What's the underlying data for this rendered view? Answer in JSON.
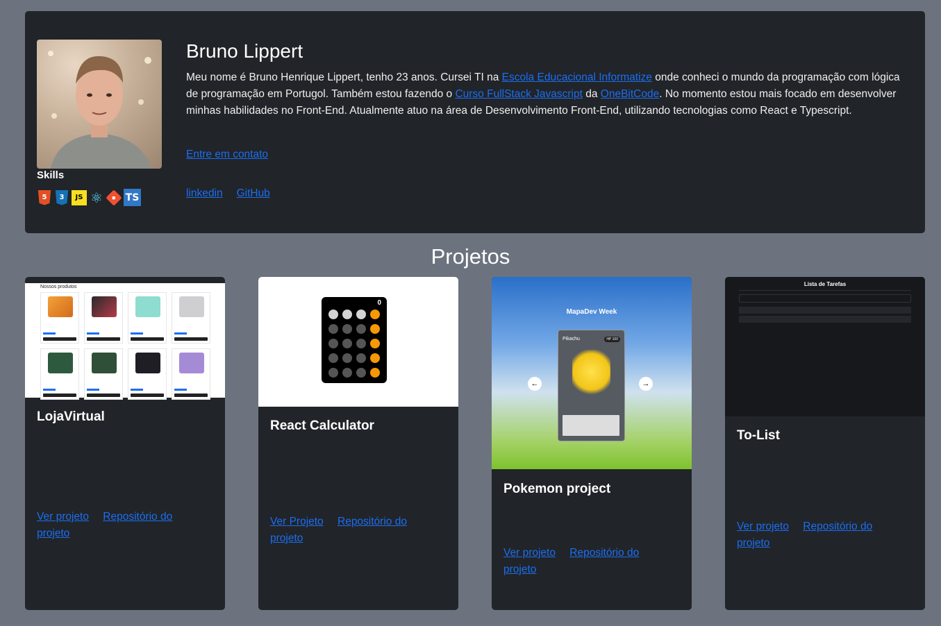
{
  "profile": {
    "name": "Bruno Lippert",
    "bio_1": "Meu nome é Bruno Henrique Lippert, tenho 23 anos. Cursei TI na ",
    "bio_link_1": "Escola Educacional Informatize",
    "bio_2": " onde conheci o mundo da programação com lógica de programação em Portugol. Também estou fazendo o ",
    "bio_link_2": "Curso FullStack Javascript",
    "bio_3": " da ",
    "bio_link_3": "OneBitCode",
    "bio_4": ". No momento estou mais focado em desenvolver minhas habilidades no Front-End. Atualmente atuo na área de Desenvolvimento Front-End, utilizando tecnologias como React e Typescript.",
    "contact": "Entre em contato",
    "skills_title": "Skills",
    "skills": [
      {
        "icon": "html5-icon",
        "glyph": "5"
      },
      {
        "icon": "css3-icon",
        "glyph": "3"
      },
      {
        "icon": "javascript-icon",
        "glyph": "JS"
      },
      {
        "icon": "react-icon",
        "glyph": "⚛"
      },
      {
        "icon": "git-icon",
        "glyph": "◆"
      },
      {
        "icon": "typescript-icon",
        "glyph": "TS"
      }
    ],
    "socials": [
      "linkedin",
      "GitHub"
    ]
  },
  "projects_title": "Projetos",
  "projects": [
    {
      "title": "LojaVirtual",
      "link_view": "Ver projeto",
      "link_repo": "Repositório do projeto"
    },
    {
      "title": "React Calculator",
      "link_view": "Ver Projeto",
      "link_repo": "Repositório do projeto"
    },
    {
      "title": "Pokemon project",
      "link_view": "Ver projeto",
      "link_repo": "Repositório do projeto"
    },
    {
      "title": "To-List",
      "link_view": "Ver projeto",
      "link_repo": "Repositório do projeto"
    }
  ],
  "thumbs": {
    "store_heading": "Nossos produtos",
    "calc_display": "0",
    "poke_title": "MapaDev Week",
    "poke_name": "Pikachu",
    "poke_hp": "HP 100",
    "todo_title": "Lista de Tarefas"
  },
  "colors": {
    "page_bg": "#6c737f",
    "card_bg": "#212428",
    "link": "#1b6ef3"
  }
}
